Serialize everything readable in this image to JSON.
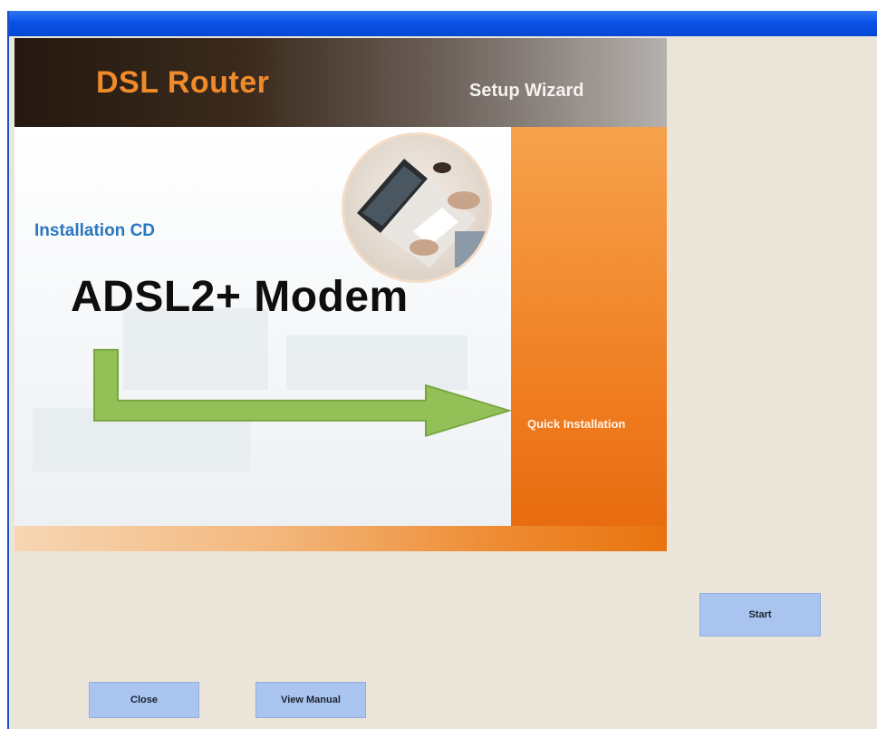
{
  "banner": {
    "brand": "DSL Router",
    "subtitle": "Setup Wizard"
  },
  "hero": {
    "cd_label": "Installation CD",
    "product": "ADSL2+ Modem",
    "menu_item": "Quick Installation"
  },
  "buttons": {
    "start": "Start",
    "close": "Close",
    "view_manual": "View Manual"
  },
  "colors": {
    "brand_orange": "#f08a2a",
    "panel_orange": "#ef7b1e",
    "label_blue": "#2a78c0",
    "arrow_green": "#93c157",
    "button_blue": "#a9c4ee",
    "window_bg": "#ece5da",
    "titlebar_blue": "#0a52e6"
  },
  "icons": {
    "arrow": "right-arrow-icon",
    "photo": "laptop-photo"
  }
}
